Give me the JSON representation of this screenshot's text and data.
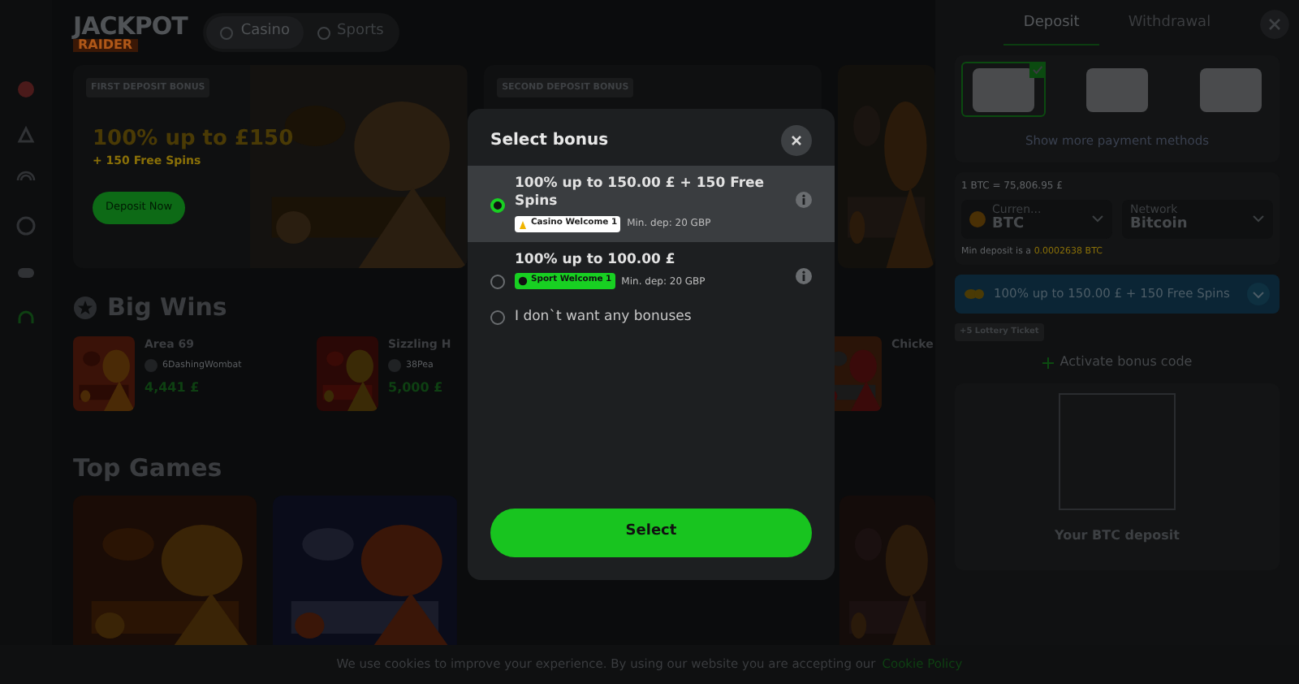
{
  "site": {
    "logo_top": "JACKPOT",
    "logo_bottom": "RAIDER",
    "nav": [
      {
        "label": "Casino",
        "selected": true
      },
      {
        "label": "Sports",
        "selected": false
      }
    ]
  },
  "banners": [
    {
      "tag": "FIRST DEPOSIT BONUS",
      "title": "100% up to £150",
      "subtitle": "+ 150 Free Spins",
      "button": "Deposit Now"
    },
    {
      "tag": "SECOND DEPOSIT BONUS"
    }
  ],
  "big_wins": {
    "title": "Big Wins",
    "items": [
      {
        "game": "Area 69",
        "player": "6DashingWombat",
        "amount": "4,441 £"
      },
      {
        "game": "Sizzling H",
        "player": "38Pea",
        "amount": "5,000 £"
      },
      {
        "game": "Chicke"
      }
    ]
  },
  "top_games": {
    "title": "Top Games"
  },
  "cookie_bar": {
    "text": "We use cookies to improve your experience. By using our website you are accepting our",
    "link": "Cookie Policy"
  },
  "deposit_panel": {
    "tabs": [
      {
        "label": "Deposit",
        "selected": true
      },
      {
        "label": "Withdrawal",
        "selected": false
      }
    ],
    "methods": [
      {
        "selected": true
      },
      {
        "selected": false
      },
      {
        "selected": false
      }
    ],
    "show_more": "Show more payment methods",
    "rate": "1 BTC = 75,806.95 £",
    "currency": {
      "label": "Curren...",
      "value": "BTC"
    },
    "network": {
      "label": "Network",
      "value": "Bitcoin"
    },
    "min_deposit": "Min deposit is a",
    "min_amount": "0.0002638 BTC",
    "bonus": "100% up to 150.00 £ + 150 Free Spins",
    "lottery": "+5 Lottery Ticket",
    "activate": "Activate bonus code",
    "deposit_caption": "Your BTC deposit"
  },
  "modal": {
    "title": "Select bonus",
    "options": [
      {
        "title": "100% up to 150.00 £ + 150 Free Spins",
        "tag": {
          "kind": "casino",
          "label": "Casino Welcome 1"
        },
        "min": "Min. dep: 20 GBP",
        "selected": true
      },
      {
        "title": "100% up to 100.00 £",
        "tag": {
          "kind": "sport",
          "label": "Sport Welcome 1"
        },
        "min": "Min. dep: 20 GBP",
        "selected": false
      },
      {
        "title": "I don`t want any bonuses",
        "selected": false
      }
    ],
    "button": "Select"
  }
}
